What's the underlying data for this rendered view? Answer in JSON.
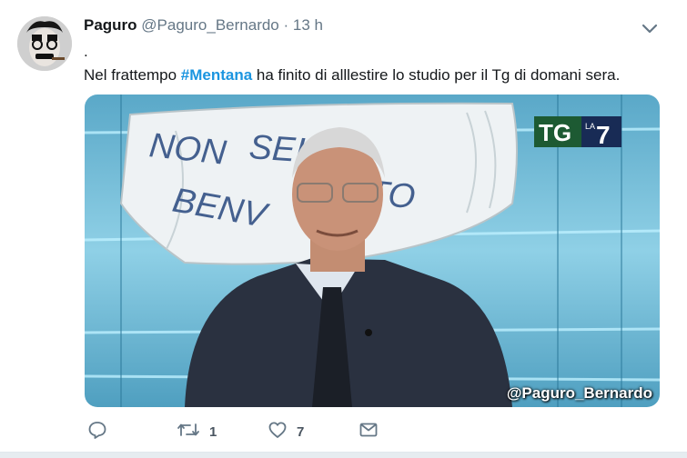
{
  "tweet": {
    "name": "Paguro",
    "handle": "@Paguro_Bernardo",
    "separator": "·",
    "time": "13 h",
    "text_line1": ".",
    "text_prefix": "Nel frattempo ",
    "hashtag": "#Mentana",
    "text_suffix": " ha finito di alllestire lo studio per il Tg di domani sera.",
    "media_watermark": "@Paguro_Bernardo",
    "logo_tg": "TG",
    "logo_la": "LA",
    "logo_7": "7"
  },
  "actions": {
    "reply_count": "",
    "retweet_count": "1",
    "like_count": "7"
  },
  "icons": [
    "chevron-down-icon",
    "reply-icon",
    "retweet-icon",
    "like-icon",
    "message-icon"
  ],
  "colors": {
    "hashtag": "#1b95e0",
    "muted": "#657786",
    "name": "#14171a"
  }
}
